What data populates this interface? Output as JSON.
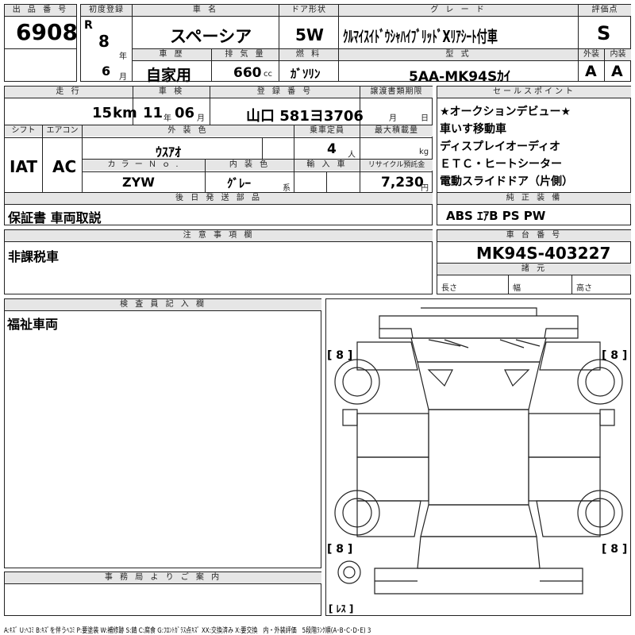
{
  "header": {
    "lot_label": "出 品 番 号",
    "lot_number": "6908",
    "first_reg_label": "初度登録",
    "era": "R",
    "year": "8",
    "year_unit": "年",
    "month": "6",
    "month_unit": "月",
    "car_name_label": "車 名",
    "car_name": "スペーシア",
    "door_label": "ドア形状",
    "door": "5W",
    "grade_label": "グ レ ー ド",
    "grade": "ｸﾙﾏｲｽｲﾄﾞｳｼｬﾊｲﾌﾞﾘｯﾄﾞXﾘｱｼｰﾄ付車",
    "score_label": "評価点",
    "score": "S",
    "history_label": "車 歴",
    "history": "自家用",
    "displacement_label": "排 気 量",
    "displacement": "660",
    "displacement_unit": "cc",
    "fuel_label": "燃 料",
    "fuel": "ｶﾞｿﾘﾝ",
    "model_label": "型 式",
    "model": "5AA-MK94Sｶｲ",
    "exterior_label": "外装",
    "exterior": "A",
    "interior_label": "内装",
    "interior": "A"
  },
  "row2": {
    "mileage_label": "走 行",
    "mileage": "15",
    "mileage_unit": "km",
    "inspection_label": "車 検",
    "inspection_year": "11",
    "inspection_year_unit": "年",
    "inspection_month": "06",
    "inspection_month_unit": "月",
    "reg_label": "登 録 番 号",
    "reg_number": "山口 581ヨ3706",
    "transfer_label": "譲渡書類期限",
    "transfer_month_unit": "月",
    "transfer_day_unit": "日",
    "shift_label": "シフト",
    "shift": "IAT",
    "ac_label": "エアコン",
    "ac": "AC",
    "color_label": "外 装 色",
    "color": "ｳｽｱｵ",
    "capacity_label": "乗車定員",
    "capacity": "4",
    "capacity_unit": "人",
    "load_label": "最大積載量",
    "load_unit": "kg",
    "color_no_label": "カ ラ ー Ｎ ｏ .",
    "color_no": "ZYW",
    "interior_color_label": "内 装 色",
    "interior_color": "ｸﾞﾚｰ",
    "interior_color_suffix": "系",
    "import_label": "輸 入 車",
    "recycle_label": "リサイクル預託金",
    "recycle": "7,230",
    "recycle_unit": "円",
    "later_parts_label": "後 日 発 送 部 品",
    "later_parts": "保証書 車両取説"
  },
  "sales_points": {
    "label": "セールスポイント",
    "items": [
      "★オークションデビュー★",
      "車いす移動車",
      "ディスプレイオーディオ",
      "ＥＴＣ・ヒートシーター",
      "電動スライドドア（片側）"
    ]
  },
  "genuine": {
    "label": "純 正 装 備",
    "value": "ABS ｴｱB PS PW"
  },
  "notes": {
    "label": "注 意 事 項 欄",
    "value": "非課税車"
  },
  "chassis": {
    "label": "車 台 番 号",
    "value": "MK94S-403227",
    "dims_label": "諸 元",
    "length_label": "長さ",
    "width_label": "幅",
    "height_label": "高さ"
  },
  "inspector": {
    "label": "検 査 員 記 入 欄",
    "value": "福祉車両"
  },
  "office": {
    "label": "事 務 局 よ り ご 案 内"
  },
  "diagram": {
    "tire_front_left": "[ 8 ]",
    "tire_front_right": "[ 8 ]",
    "tire_rear_left": "[ 8 ]",
    "tire_rear_right": "[ 8 ]",
    "spare_label": "[ ﾚｽ ]"
  },
  "legend": "A:ｷｽﾞ U:ﾍｺﾐ B:ｷｽﾞを伴うﾍｺﾐ P:要塗装 W:補修跡 S:錆 C:腐食 G:ﾌﾛﾝﾄｶﾞﾗｽ点ｷｽﾞ XX:交換済み X:要交換　内・外装評価　5段階ﾗﾝｸ順(A･B･C･D･E) 3"
}
